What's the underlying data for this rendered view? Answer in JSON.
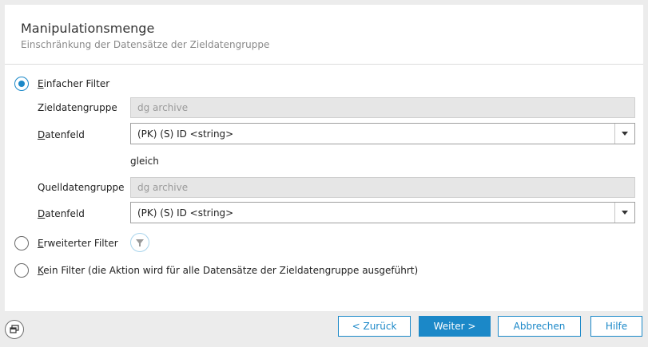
{
  "header": {
    "title": "Manipulationsmenge",
    "subtitle": "Einschränkung der Datensätze der Zieldatengruppe"
  },
  "options": {
    "simple": {
      "first": "E",
      "rest": "infacher Filter",
      "selected": true
    },
    "extended": {
      "first": "E",
      "rest": "rweiterter Filter",
      "selected": false
    },
    "none": {
      "first": "K",
      "rest": "ein Filter (die Aktion wird für alle Datensätze der Zieldatengruppe ausgeführt)",
      "selected": false
    }
  },
  "simple_filter": {
    "target_group_label": "Zieldatengruppe",
    "target_group_value": "dg archive",
    "target_field_label": {
      "first": "D",
      "rest": "atenfeld"
    },
    "target_field_value": "(PK) (S) ID <string>",
    "operator": "gleich",
    "source_group_label": "Quelldatengruppe",
    "source_group_value": "dg archive",
    "source_field_label": {
      "first": "D",
      "rest": "atenfeld"
    },
    "source_field_value": "(PK) (S) ID <string>"
  },
  "footer": {
    "back": "< Zurück",
    "next": "Weiter >",
    "cancel": "Abbrechen",
    "help": "Hilfe"
  },
  "colors": {
    "accent": "#1b88c8",
    "panel": "#ffffff",
    "background": "#ececec"
  }
}
